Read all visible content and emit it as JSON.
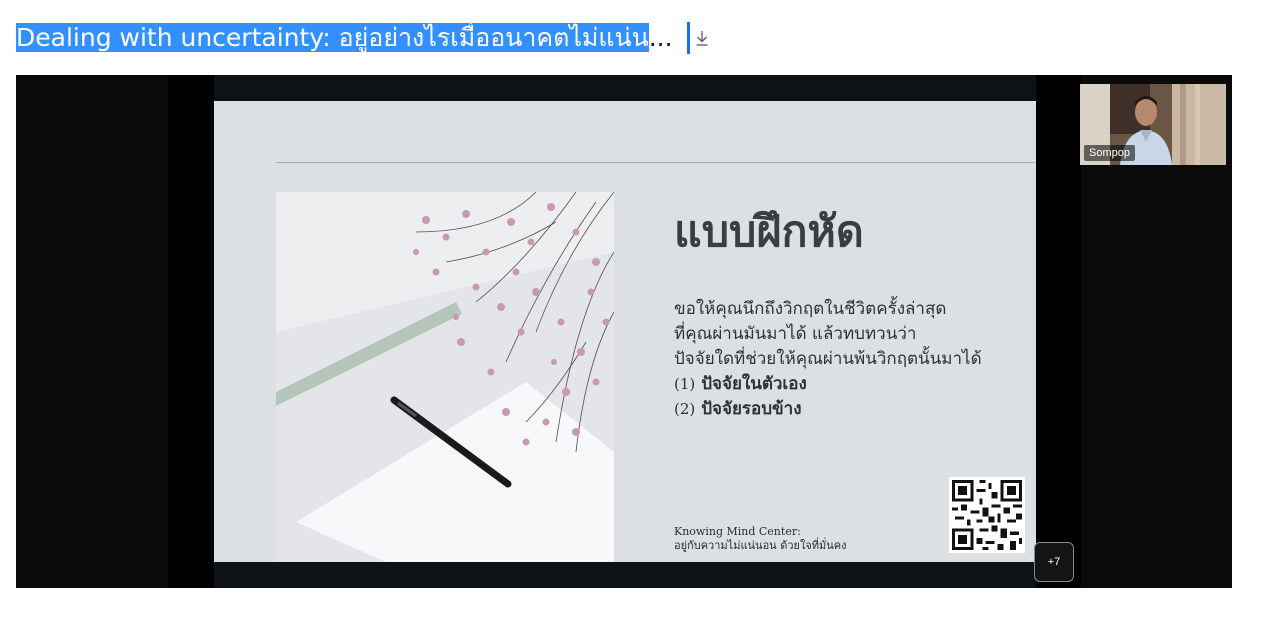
{
  "header": {
    "title_selected": "Dealing with uncertainty: อยู่อย่างไรเมื่ออนาคตไม่แน่น",
    "title_rest": "...",
    "download_icon": "download-arrow-icon"
  },
  "slide": {
    "heading": "แบบฝึกหัด",
    "lines": [
      "ขอให้คุณนึกถึงวิกฤตในชีวิตครั้งล่าสุด",
      "ที่คุณผ่านมันมาได้ แล้วทบทวนว่า",
      "ปัจจัยใดที่ช่วยให้คุณผ่านพ้นวิกฤตนั้นมาได้"
    ],
    "items": [
      {
        "num": "(1)",
        "label": "ปัจจัยในตัวเอง"
      },
      {
        "num": "(2)",
        "label": "ปัจจัยรอบข้าง"
      }
    ],
    "footer_line1": "Knowing Mind Center:",
    "footer_line2": "อยู่กับความไม่แน่นอน ด้วยใจที่มั่นคง"
  },
  "participant": {
    "name": "Sompop"
  },
  "more_participants": "+7",
  "colors": {
    "selection": "#3390ff",
    "caret": "#1a73e8",
    "slide_bg": "#dde0e2"
  }
}
